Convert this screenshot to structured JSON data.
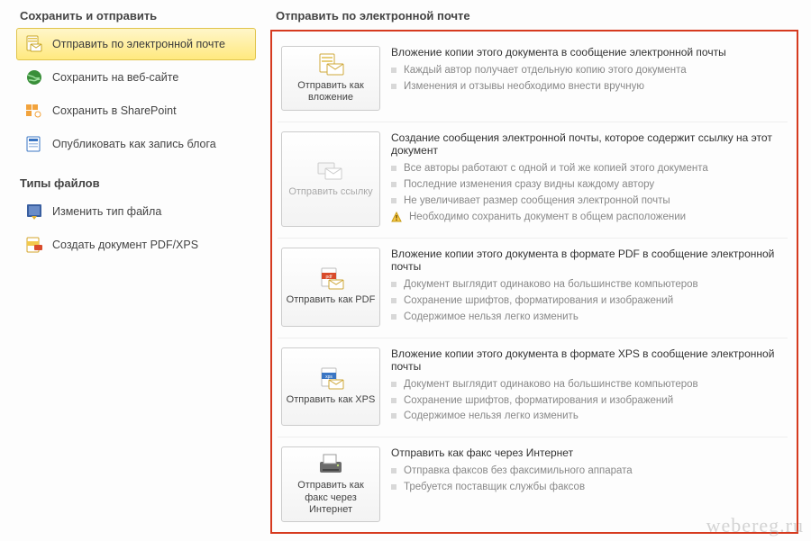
{
  "sidebar": {
    "group1_title": "Сохранить и отправить",
    "group1_items": [
      {
        "label": "Отправить по электронной почте",
        "icon": "mail-page-icon"
      },
      {
        "label": "Сохранить на веб-сайте",
        "icon": "globe-icon"
      },
      {
        "label": "Сохранить в SharePoint",
        "icon": "sharepoint-icon"
      },
      {
        "label": "Опубликовать как запись блога",
        "icon": "blog-icon"
      }
    ],
    "group2_title": "Типы файлов",
    "group2_items": [
      {
        "label": "Изменить тип файла",
        "icon": "change-filetype-icon"
      },
      {
        "label": "Создать документ PDF/XPS",
        "icon": "pdf-xps-icon"
      }
    ]
  },
  "main": {
    "title": "Отправить по электронной почте",
    "options": [
      {
        "button_label": "Отправить как вложение",
        "icon": "attachment-mail-icon",
        "disabled": false,
        "headline": "Вложение копии этого документа в сообщение электронной почты",
        "items": [
          {
            "type": "sq",
            "text": "Каждый автор получает отдельную копию этого документа"
          },
          {
            "type": "sq",
            "text": "Изменения и отзывы необходимо внести вручную"
          }
        ]
      },
      {
        "button_label": "Отправить ссылку",
        "icon": "send-link-icon",
        "disabled": true,
        "headline": "Создание сообщения электронной почты, которое содержит ссылку на этот документ",
        "items": [
          {
            "type": "sq",
            "text": "Все авторы работают с одной и той же копией этого документа"
          },
          {
            "type": "sq",
            "text": "Последние изменения сразу видны каждому автору"
          },
          {
            "type": "sq",
            "text": "Не увеличивает размер сообщения электронной почты"
          },
          {
            "type": "warn",
            "text": "Необходимо сохранить документ в общем расположении"
          }
        ]
      },
      {
        "button_label": "Отправить как PDF",
        "icon": "pdf-icon",
        "disabled": false,
        "headline": "Вложение копии этого документа в формате PDF в сообщение электронной почты",
        "items": [
          {
            "type": "sq",
            "text": "Документ выглядит одинаково на большинстве компьютеров"
          },
          {
            "type": "sq",
            "text": "Сохранение шрифтов, форматирования и изображений"
          },
          {
            "type": "sq",
            "text": "Содержимое нельзя легко изменить"
          }
        ]
      },
      {
        "button_label": "Отправить как XPS",
        "icon": "xps-icon",
        "disabled": false,
        "headline": "Вложение копии этого документа в формате XPS в сообщение электронной почты",
        "items": [
          {
            "type": "sq",
            "text": "Документ выглядит одинаково на большинстве компьютеров"
          },
          {
            "type": "sq",
            "text": "Сохранение шрифтов, форматирования и изображений"
          },
          {
            "type": "sq",
            "text": "Содержимое нельзя легко изменить"
          }
        ]
      },
      {
        "button_label": "Отправить как факс через Интернет",
        "icon": "fax-icon",
        "disabled": false,
        "headline": "Отправить как факс через Интернет",
        "items": [
          {
            "type": "sq",
            "text": "Отправка факсов без факсимильного аппарата"
          },
          {
            "type": "sq",
            "text": "Требуется поставщик службы факсов"
          }
        ]
      }
    ]
  },
  "watermark": "webereg.ru"
}
